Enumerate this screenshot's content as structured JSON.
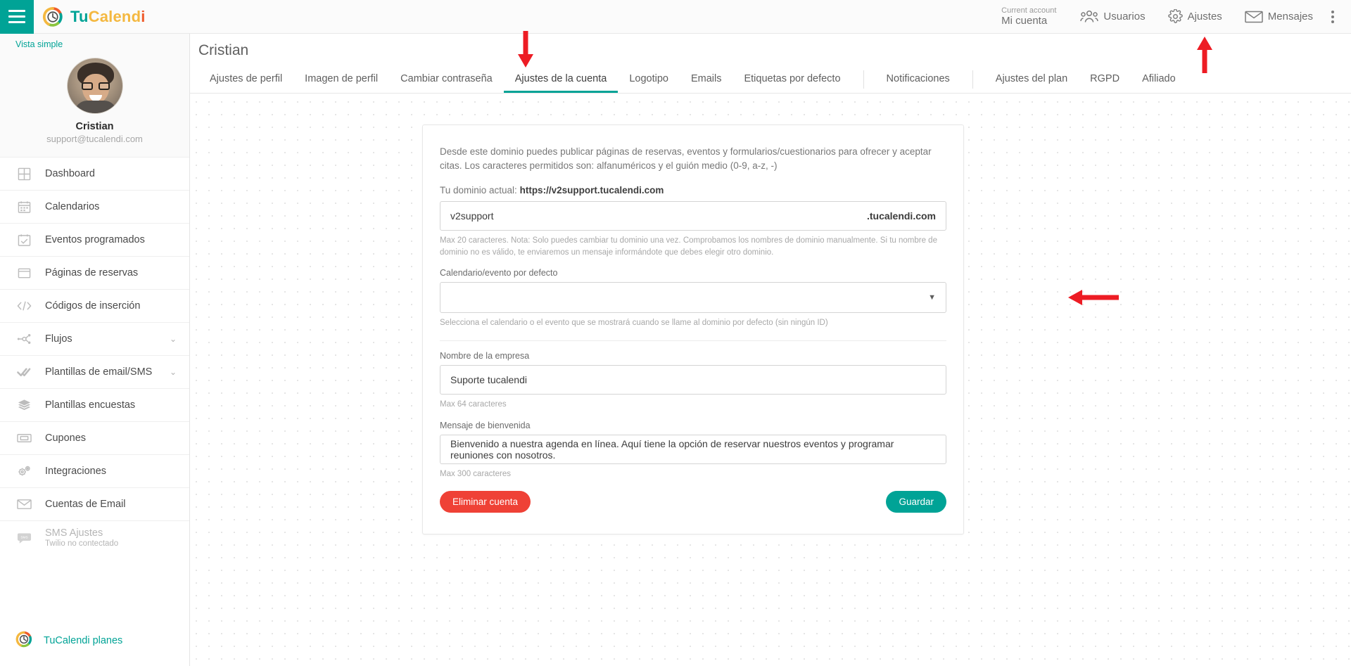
{
  "topbar": {
    "menu_icon": "hamburger-icon",
    "brand": {
      "part1": "Tu",
      "part2": "Calend",
      "part3": "i"
    },
    "account_label": "Current account",
    "account_value": "Mi cuenta",
    "items": [
      {
        "label": "Usuarios",
        "icon": "users-icon"
      },
      {
        "label": "Ajustes",
        "icon": "gear-icon"
      },
      {
        "label": "Mensajes",
        "icon": "envelope-icon"
      }
    ],
    "overflow_icon": "kebab-menu-icon"
  },
  "sidebar": {
    "simple_view": "Vista simple",
    "profile": {
      "name": "Cristian",
      "email": "support@tucalendi.com"
    },
    "items": [
      {
        "label": "Dashboard",
        "icon": "dashboard-grid-icon",
        "chevron": "",
        "sub": "",
        "muted": false
      },
      {
        "label": "Calendarios",
        "icon": "calendar-icon",
        "chevron": "",
        "sub": "",
        "muted": false
      },
      {
        "label": "Eventos programados",
        "icon": "calendar-check-icon",
        "chevron": "",
        "sub": "",
        "muted": false
      },
      {
        "label": "Páginas de reservas",
        "icon": "window-icon",
        "chevron": "",
        "sub": "",
        "muted": false
      },
      {
        "label": "Códigos de inserción",
        "icon": "code-icon",
        "chevron": "",
        "sub": "",
        "muted": false
      },
      {
        "label": "Flujos",
        "icon": "flow-nodes-icon",
        "chevron": "⌄",
        "sub": "",
        "muted": false
      },
      {
        "label": "Plantillas de email/SMS",
        "icon": "double-check-icon",
        "chevron": "⌄",
        "sub": "",
        "muted": false
      },
      {
        "label": "Plantillas encuestas",
        "icon": "layers-icon",
        "chevron": "",
        "sub": "",
        "muted": false
      },
      {
        "label": "Cupones",
        "icon": "ticket-icon",
        "chevron": "",
        "sub": "",
        "muted": false
      },
      {
        "label": "Integraciones",
        "icon": "gears-icon",
        "chevron": "",
        "sub": "",
        "muted": false
      },
      {
        "label": "Cuentas de Email",
        "icon": "envelope-icon",
        "chevron": "",
        "sub": "",
        "muted": false
      },
      {
        "label": "SMS Ajustes",
        "icon": "sms-bubble-icon",
        "chevron": "",
        "sub": "Twilio no contectado",
        "muted": true
      }
    ],
    "plans_label": "TuCalendi planes"
  },
  "main": {
    "page_title": "Cristian",
    "tabs": [
      {
        "label": "Ajustes de perfil",
        "active": false,
        "sep_after": false
      },
      {
        "label": "Imagen de perfil",
        "active": false,
        "sep_after": false
      },
      {
        "label": "Cambiar contraseña",
        "active": false,
        "sep_after": false
      },
      {
        "label": "Ajustes de la cuenta",
        "active": true,
        "sep_after": false
      },
      {
        "label": "Logotipo",
        "active": false,
        "sep_after": false
      },
      {
        "label": "Emails",
        "active": false,
        "sep_after": false
      },
      {
        "label": "Etiquetas por defecto",
        "active": false,
        "sep_after": true
      },
      {
        "label": "Notificaciones",
        "active": false,
        "sep_after": true
      },
      {
        "label": "Ajustes del plan",
        "active": false,
        "sep_after": false
      },
      {
        "label": "RGPD",
        "active": false,
        "sep_after": false
      },
      {
        "label": "Afiliado",
        "active": false,
        "sep_after": false
      }
    ],
    "card": {
      "intro": "Desde este dominio puedes publicar páginas de reservas, eventos y formularios/cuestionarios para ofrecer y aceptar citas. Los caracteres permitidos son: alfanuméricos y el guión medio (0-9, a-z, -)",
      "current_domain_label": "Tu dominio actual:",
      "current_domain_value": "https://v2support.tucalendi.com",
      "domain_field": {
        "value": "v2support",
        "suffix": ".tucalendi.com",
        "hint": "Max 20 caracteres. Nota: Solo puedes cambiar tu dominio una vez. Comprobamos los nombres de dominio manualmente. Si tu nombre de dominio no es válido, te enviaremos un mensaje informándote que debes elegir otro dominio."
      },
      "default_calendar": {
        "label": "Calendario/evento por defecto",
        "value": "",
        "caret_icon": "chevron-down-icon",
        "hint": "Selecciona el calendario o el evento que se mostrará cuando se llame al dominio por defecto (sin ningún ID)"
      },
      "company_name": {
        "label": "Nombre de la empresa",
        "value": "Suporte tucalendi",
        "hint": "Max 64 caracteres"
      },
      "welcome_message": {
        "label": "Mensaje de bienvenida",
        "value": "Bienvenido a nuestra agenda en línea. Aquí tiene la opción de reservar nuestros eventos y programar reuniones con nosotros.",
        "hint": "Max 300 caracteres"
      },
      "delete_button": "Eliminar cuenta",
      "save_button": "Guardar"
    }
  },
  "annotations": {
    "color": "#ed1c24",
    "arrows": [
      {
        "name": "arrow-pointing-to-account-settings-tab",
        "direction": "down"
      },
      {
        "name": "arrow-pointing-to-ajustes-menu",
        "direction": "up"
      },
      {
        "name": "arrow-pointing-to-default-calendar-select",
        "direction": "left"
      }
    ]
  },
  "colors": {
    "accent_teal": "#00a396",
    "danger_red": "#ef4136",
    "brand_yellow": "#f4b840",
    "brand_orange": "#ef5b2b",
    "brand_green": "#8bc53f"
  }
}
